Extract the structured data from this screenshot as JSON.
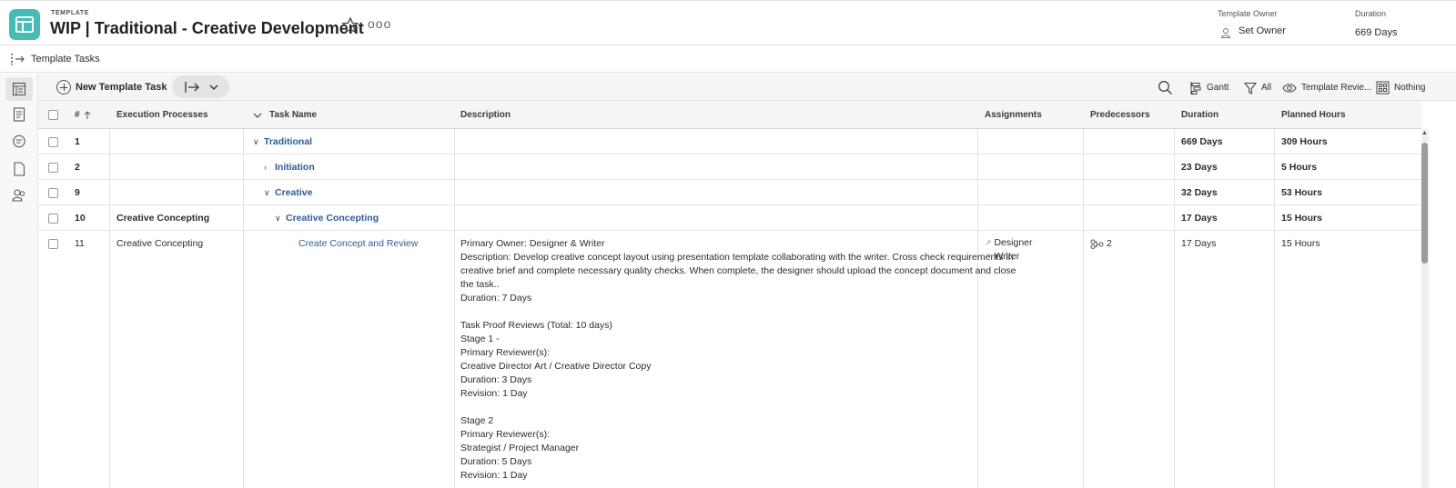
{
  "header": {
    "kicker": "TEMPLATE",
    "title": "WIP | Traditional - Creative Development",
    "more": "ooo",
    "owner_label": "Template Owner",
    "owner_value": "Set Owner",
    "duration_label": "Duration",
    "duration_value": "669 Days"
  },
  "subheader": {
    "label": "Template Tasks"
  },
  "toolbar": {
    "new_task": "New Template Task",
    "gantt": "Gantt",
    "filter": "All",
    "view": "Template Revie...",
    "grouping": "Nothing"
  },
  "columns": {
    "num": "#",
    "exec": "Execution Processes",
    "task": "Task Name",
    "desc": "Description",
    "assign": "Assignments",
    "pred": "Predecessors",
    "dur": "Duration",
    "hours": "Planned Hours"
  },
  "rows": [
    {
      "num": "1",
      "exec": "",
      "task": "Traditional",
      "dur": "669 Days",
      "hours": "309 Hours"
    },
    {
      "num": "2",
      "exec": "",
      "task": "Initiation",
      "dur": "23 Days",
      "hours": "5 Hours"
    },
    {
      "num": "9",
      "exec": "",
      "task": "Creative",
      "dur": "32 Days",
      "hours": "53 Hours"
    },
    {
      "num": "10",
      "exec": "Creative Concepting",
      "task": "Creative Concepting",
      "dur": "17 Days",
      "hours": "15 Hours"
    },
    {
      "num": "11",
      "exec": "Creative Concepting",
      "task": "Create Concept and Review",
      "desc": "Primary Owner: Designer & Writer\nDescription: Develop creative concept layout using presentation template collaborating with the writer. Cross check requirements in\ncreative brief and complete necessary quality checks. When complete, the designer should upload the concept document and close\nthe task..\nDuration: 7 Days\n\nTask Proof Reviews (Total: 10 days)\nStage 1 -\nPrimary Reviewer(s):\nCreative Director Art / Creative Director Copy\nDuration: 3 Days\nRevision: 1 Day\n\nStage 2\nPrimary Reviewer(s):\nStrategist / Project Manager\nDuration: 5 Days\nRevision: 1 Day",
      "assign1": "Designer",
      "assign2": "Writer",
      "pred": "2",
      "dur": "17 Days",
      "hours": "15 Hours"
    }
  ],
  "colors": {
    "accent": "#45bcb5",
    "link": "#2d5b95"
  },
  "icons": [
    "template-icon",
    "star-icon",
    "owner-icon",
    "tasks-icon",
    "search-icon",
    "gantt-icon",
    "filter-icon",
    "eye-icon",
    "grouping-icon"
  ]
}
